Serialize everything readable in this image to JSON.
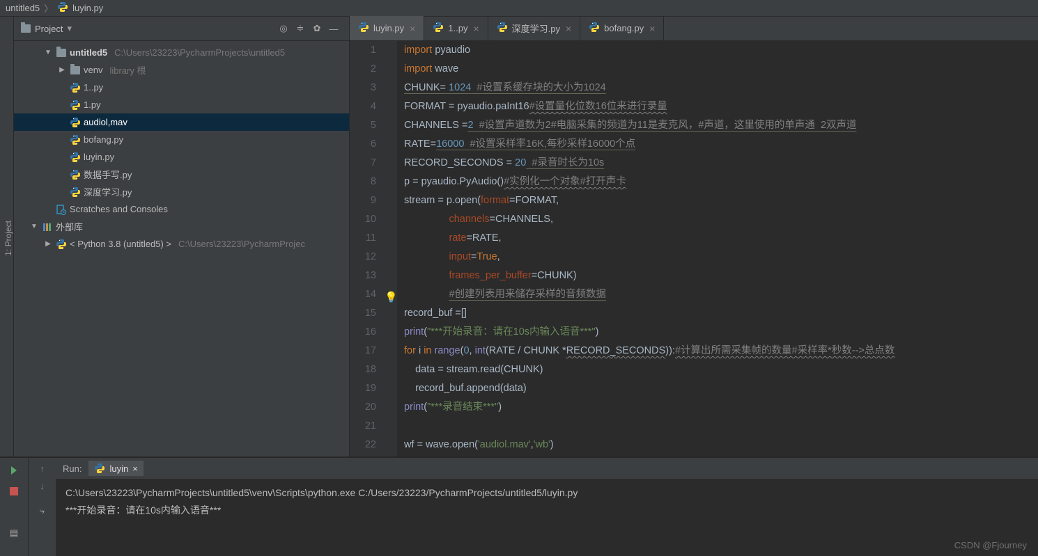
{
  "breadcrumb": {
    "project": "untitled5",
    "file": "luyin.py"
  },
  "project_panel": {
    "title": "Project",
    "tree": [
      {
        "depth": 0,
        "arrow": "▼",
        "icon": "folder",
        "label": "untitled5",
        "bold": true,
        "dim": "C:\\Users\\23223\\PycharmProjects\\untitled5"
      },
      {
        "depth": 1,
        "arrow": "▶",
        "icon": "folder",
        "label": "venv",
        "dim": "library 根"
      },
      {
        "depth": 1,
        "arrow": "",
        "icon": "py",
        "label": "1..py"
      },
      {
        "depth": 1,
        "arrow": "",
        "icon": "py",
        "label": "1.py"
      },
      {
        "depth": 1,
        "arrow": "",
        "icon": "py",
        "label": "audiol,mav",
        "selected": true
      },
      {
        "depth": 1,
        "arrow": "",
        "icon": "py",
        "label": "bofang.py"
      },
      {
        "depth": 1,
        "arrow": "",
        "icon": "py",
        "label": "luyin.py"
      },
      {
        "depth": 1,
        "arrow": "",
        "icon": "py",
        "label": "数据手写.py"
      },
      {
        "depth": 1,
        "arrow": "",
        "icon": "py",
        "label": "深度学习.py"
      },
      {
        "depth": 0,
        "arrow": "",
        "icon": "scratch",
        "label": "Scratches and Consoles"
      },
      {
        "depth": -1,
        "arrow": "▼",
        "icon": "lib",
        "label": "外部库"
      },
      {
        "depth": 0,
        "arrow": "▶",
        "icon": "python",
        "label": "< Python 3.8 (untitled5) >",
        "dim": "C:\\Users\\23223\\PycharmProjec"
      }
    ]
  },
  "tabs": [
    {
      "label": "luyin.py",
      "active": true
    },
    {
      "label": "1..py"
    },
    {
      "label": "深度学习.py"
    },
    {
      "label": "bofang.py"
    }
  ],
  "code": {
    "bulb_line": 14,
    "highlight_line": 14,
    "lines": [
      [
        {
          "t": "import ",
          "c": "kw"
        },
        {
          "t": "pyaudio"
        }
      ],
      [
        {
          "t": "import ",
          "c": "kw"
        },
        {
          "t": "wave"
        }
      ],
      [
        {
          "t": "CHUNK= ",
          "c": "undc"
        },
        {
          "t": "1024",
          "c": "num undc"
        },
        {
          "t": "  #设置系缓存块的大小为1024",
          "c": "cmt undc"
        }
      ],
      [
        {
          "t": "FORMAT = pyaudio.paInt16"
        },
        {
          "t": "#设置量化位数16位来进行录量",
          "c": "cmt und"
        }
      ],
      [
        {
          "t": "CHANNELS ="
        },
        {
          "t": "2",
          "c": "num undc"
        },
        {
          "t": "  #设置声道数为2#电脑采集的频道为11是麦克风，#声道，这里使用的单声通  2双声道",
          "c": "cmt undc"
        }
      ],
      [
        {
          "t": "RATE="
        },
        {
          "t": "16000",
          "c": "num undc"
        },
        {
          "t": "  #设置采样率16K,每秒采样16000个点",
          "c": "cmt undc"
        }
      ],
      [
        {
          "t": "RECORD_SECONDS = "
        },
        {
          "t": "20",
          "c": "num"
        },
        {
          "t": "  #录音时长为10s",
          "c": "cmt undc"
        }
      ],
      [
        {
          "t": "p = pyaudio.PyAudio()"
        },
        {
          "t": "#实例化一个对象#打开声卡",
          "c": "cmt und"
        }
      ],
      [
        {
          "t": "stream = p.open("
        },
        {
          "t": "format",
          "c": "par"
        },
        {
          "t": "=FORMAT"
        },
        {
          "t": ","
        }
      ],
      [
        {
          "t": "                "
        },
        {
          "t": "channels",
          "c": "par"
        },
        {
          "t": "=CHANNELS"
        },
        {
          "t": ","
        }
      ],
      [
        {
          "t": "                "
        },
        {
          "t": "rate",
          "c": "par"
        },
        {
          "t": "=RATE"
        },
        {
          "t": ","
        }
      ],
      [
        {
          "t": "                "
        },
        {
          "t": "input",
          "c": "par"
        },
        {
          "t": "="
        },
        {
          "t": "True",
          "c": "kw"
        },
        {
          "t": ","
        }
      ],
      [
        {
          "t": "                "
        },
        {
          "t": "frames_per_buffer",
          "c": "par"
        },
        {
          "t": "=CHUNK)"
        }
      ],
      [
        {
          "t": "                "
        },
        {
          "t": "#创建列表用来储存采样的音频数据",
          "c": "cmt undc"
        }
      ],
      [
        {
          "t": "record_buf =[]"
        }
      ],
      [
        {
          "t": "print",
          "c": "bif"
        },
        {
          "t": "("
        },
        {
          "t": "\"***开始录音：请在10s内输入语音***\"",
          "c": "str"
        },
        {
          "t": ")"
        }
      ],
      [
        {
          "t": "for ",
          "c": "kw"
        },
        {
          "t": "i "
        },
        {
          "t": "in ",
          "c": "kw"
        },
        {
          "t": "range",
          "c": "bif"
        },
        {
          "t": "("
        },
        {
          "t": "0",
          "c": "num"
        },
        {
          "t": ", "
        },
        {
          "t": "int",
          "c": "bif"
        },
        {
          "t": "(RATE / CHUNK *"
        },
        {
          "t": "RECORD_SECONDS",
          "c": "und"
        },
        {
          "t": ")):"
        },
        {
          "t": "#计算出所需采集帧的数量#采样率*秒数-->总点数",
          "c": "cmt und"
        }
      ],
      [
        {
          "t": "    data = stream.read(CHUNK)"
        }
      ],
      [
        {
          "t": "    record_buf.append(data)"
        }
      ],
      [
        {
          "t": "print",
          "c": "bif"
        },
        {
          "t": "("
        },
        {
          "t": "\"***录音结束***\"",
          "c": "str"
        },
        {
          "t": ")"
        }
      ],
      [
        {
          "t": ""
        }
      ],
      [
        {
          "t": "wf = wave.open("
        },
        {
          "t": "'audiol.mav'",
          "c": "str"
        },
        {
          "t": ","
        },
        {
          "t": "'wb'",
          "c": "str"
        },
        {
          "t": ")"
        }
      ]
    ]
  },
  "run": {
    "label": "Run:",
    "config": "luyin",
    "out1": "C:\\Users\\23223\\PycharmProjects\\untitled5\\venv\\Scripts\\python.exe C:/Users/23223/PycharmProjects/untitled5/luyin.py",
    "out2": "***开始录音：请在10s内输入语音***"
  },
  "watermark": "CSDN @Fjourney"
}
